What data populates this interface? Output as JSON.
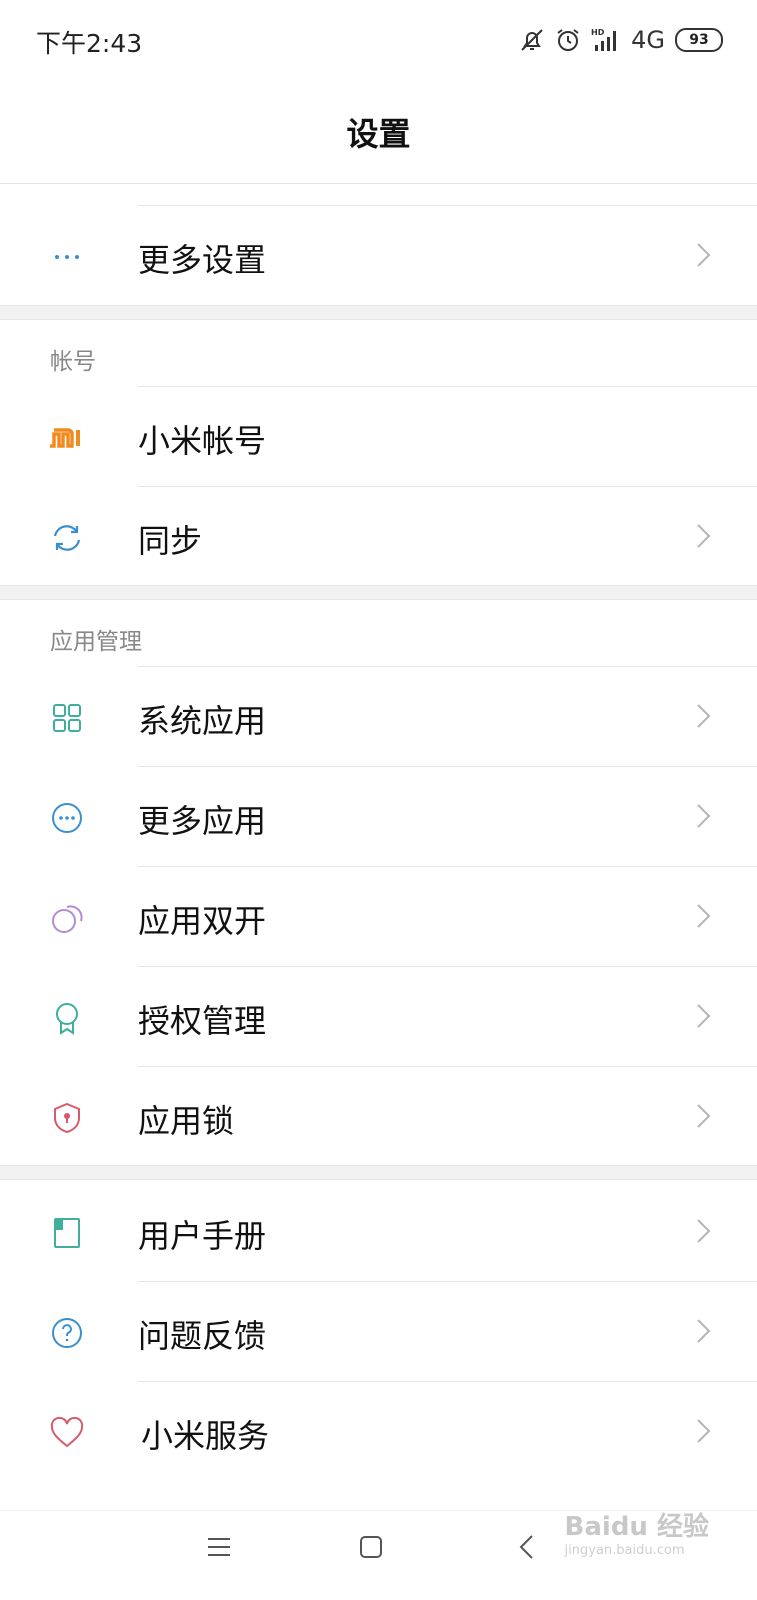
{
  "status_bar": {
    "time": "下午2:43",
    "network": "4G",
    "battery": "93"
  },
  "header": {
    "title": "设置"
  },
  "top_group": {
    "items": [
      {
        "label": "更多设置",
        "icon": "more-dots-icon",
        "color": "#3a8fd0"
      }
    ]
  },
  "account_section": {
    "header": "帐号",
    "items": [
      {
        "label": "小米帐号",
        "icon": "mi-logo-icon",
        "color": "#f28b1d"
      },
      {
        "label": "同步",
        "icon": "sync-icon",
        "color": "#3a8fd0"
      }
    ]
  },
  "app_section": {
    "header": "应用管理",
    "items": [
      {
        "label": "系统应用",
        "icon": "grid-apps-icon",
        "color": "#3fae9a"
      },
      {
        "label": "更多应用",
        "icon": "more-circle-icon",
        "color": "#3a8fd0"
      },
      {
        "label": "应用双开",
        "icon": "dual-circles-icon",
        "color": "#b48ad8"
      },
      {
        "label": "授权管理",
        "icon": "ribbon-badge-icon",
        "color": "#3fae9a"
      },
      {
        "label": "应用锁",
        "icon": "shield-lock-icon",
        "color": "#d65a6a"
      }
    ]
  },
  "help_section": {
    "items": [
      {
        "label": "用户手册",
        "icon": "book-icon",
        "color": "#3fae9a"
      },
      {
        "label": "问题反馈",
        "icon": "question-icon",
        "color": "#3a8fd0"
      },
      {
        "label": "小米服务",
        "icon": "heart-icon",
        "color": "#d65a6a"
      }
    ]
  },
  "watermark": {
    "brand": "Baidu 经验",
    "url": "jingyan.baidu.com"
  }
}
